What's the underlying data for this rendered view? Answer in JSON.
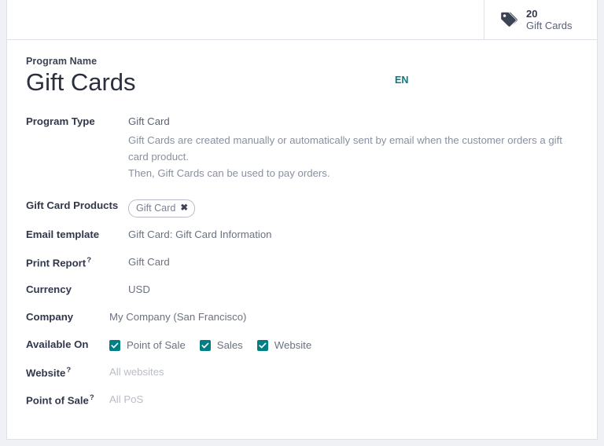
{
  "stat_button": {
    "icon": "tag-icon",
    "value": "20",
    "label": "Gift Cards"
  },
  "form": {
    "title_label": "Program Name",
    "title_value": "Gift Cards",
    "language_badge": "EN",
    "program_type": {
      "label": "Program Type",
      "value": "Gift Card",
      "description_line1": "Gift Cards are created manually or automatically sent by email when the customer orders a gift card product.",
      "description_line2": "Then, Gift Cards can be used to pay orders."
    },
    "gift_card_products": {
      "label": "Gift Card Products",
      "tags": [
        {
          "text": "Gift Card",
          "remove_icon": "close-icon"
        }
      ]
    },
    "email_template": {
      "label": "Email template",
      "value": "Gift Card: Gift Card Information"
    },
    "print_report": {
      "label": "Print Report",
      "help": "?",
      "value": "Gift Card"
    },
    "currency": {
      "label": "Currency",
      "value": "USD"
    },
    "company": {
      "label": "Company",
      "value": "My Company (San Francisco)"
    },
    "available_on": {
      "label": "Available On",
      "options": [
        {
          "label": "Point of Sale",
          "checked": true
        },
        {
          "label": "Sales",
          "checked": true
        },
        {
          "label": "Website",
          "checked": true
        }
      ]
    },
    "website": {
      "label": "Website",
      "help": "?",
      "placeholder": "All websites"
    },
    "point_of_sale": {
      "label": "Point of Sale",
      "help": "?",
      "placeholder": "All PoS"
    }
  },
  "colors": {
    "accent": "#017e84",
    "text_dark": "#32374b",
    "text_muted": "#6b7280",
    "placeholder": "#b9bdc8",
    "border": "#dee1e8"
  }
}
